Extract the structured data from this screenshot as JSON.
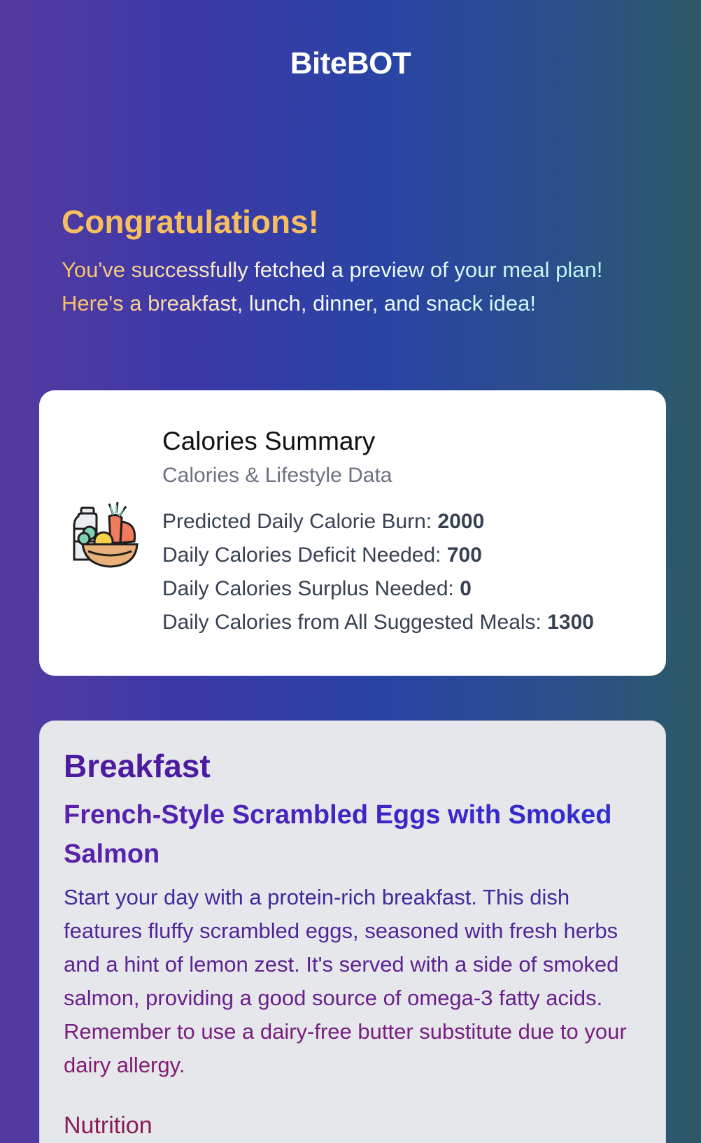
{
  "header": {
    "brand": "BiteBOT"
  },
  "hero": {
    "title": "Congratulations!",
    "text": "You've successfully fetched a preview of your meal plan! Here's a breakfast, lunch, dinner, and snack idea!"
  },
  "summary": {
    "icon": "food-basket-icon",
    "title": "Calories Summary",
    "subtitle": "Calories & Lifestyle Data",
    "stats": [
      {
        "label": "Predicted Daily Calorie Burn:",
        "value": "2000"
      },
      {
        "label": "Daily Calories Deficit Needed:",
        "value": "700"
      },
      {
        "label": "Daily Calories Surplus Needed:",
        "value": "0"
      },
      {
        "label": "Daily Calories from All Suggested Meals:",
        "value": "1300"
      }
    ]
  },
  "meals": [
    {
      "label": "Breakfast",
      "name": "French-Style Scrambled Eggs with Smoked Salmon",
      "description": "Start your day with a protein-rich breakfast. This dish features fluffy scrambled eggs, seasoned with fresh herbs and a hint of lemon zest. It's served with a side of smoked salmon, providing a good source of omega-3 fatty acids. Remember to use a dairy-free butter substitute due to your dairy allergy.",
      "nutrition_heading": "Nutrition"
    }
  ]
}
